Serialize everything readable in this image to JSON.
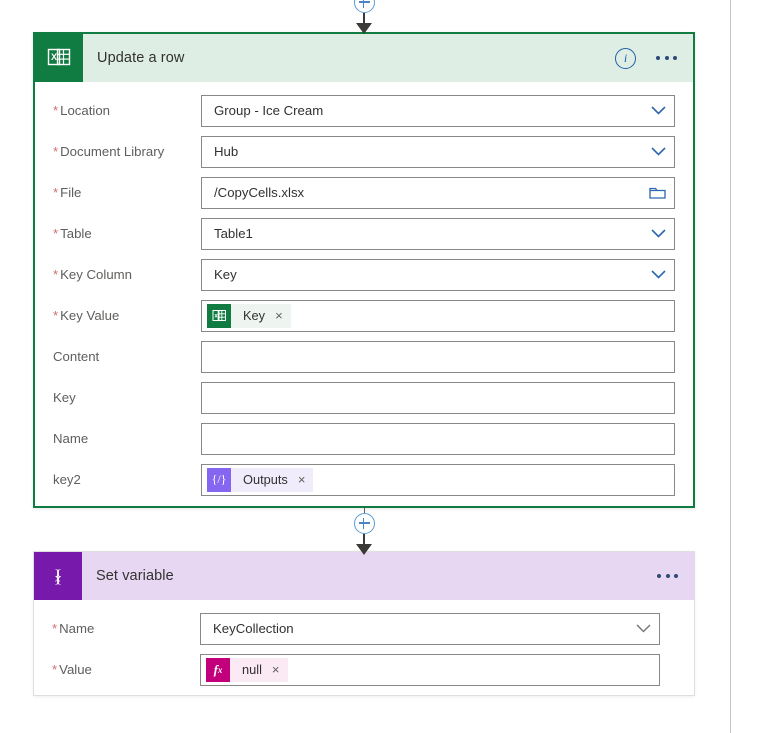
{
  "flow": {
    "connectors": [
      {
        "name": "connector-top",
        "icon": "plus-icon",
        "tooltip": "Insert a new step"
      },
      {
        "name": "connector-middle",
        "icon": "plus-icon",
        "tooltip": "Insert a new step"
      }
    ],
    "cards": [
      {
        "id": "update-a-row",
        "title": "Update a row",
        "icon": "excel-icon",
        "accent": "#107c41",
        "header_background": "#dfeee5",
        "selected": true,
        "header_buttons": [
          {
            "name": "info-button",
            "icon": "info-icon",
            "label": "i"
          },
          {
            "name": "more-commands-button",
            "icon": "ellipsis-icon",
            "label": "..."
          }
        ],
        "fields": [
          {
            "label": "Location",
            "required": true,
            "value": "Group - Ice Cream",
            "control": "dropdown"
          },
          {
            "label": "Document Library",
            "required": true,
            "value": "Hub",
            "control": "dropdown"
          },
          {
            "label": "File",
            "required": true,
            "value": "/CopyCells.xlsx",
            "control": "filepicker"
          },
          {
            "label": "Table",
            "required": true,
            "value": "Table1",
            "control": "dropdown"
          },
          {
            "label": "Key Column",
            "required": true,
            "value": "Key",
            "control": "dropdown"
          },
          {
            "label": "Key Value",
            "required": true,
            "value": "",
            "control": "token",
            "token": {
              "text": "Key",
              "icon": "excel-icon",
              "icon_color": "#107c41",
              "chip_color": "#eef5f0",
              "remove": "×"
            }
          },
          {
            "label": "Content",
            "required": false,
            "value": "",
            "control": "text"
          },
          {
            "label": "Key",
            "required": false,
            "value": "",
            "control": "text"
          },
          {
            "label": "Name",
            "required": false,
            "value": "",
            "control": "text"
          },
          {
            "label": "key2",
            "required": false,
            "value": "",
            "control": "token",
            "token": {
              "text": "Outputs",
              "icon": "code-icon",
              "icon_color": "#8566f0",
              "chip_color": "#f0ecfb",
              "remove": "×"
            }
          }
        ]
      },
      {
        "id": "set-variable",
        "title": "Set variable",
        "icon": "variable-icon",
        "accent": "#7719aa",
        "header_background": "#e8d7f3",
        "selected": false,
        "header_buttons": [
          {
            "name": "more-commands-button",
            "icon": "ellipsis-icon",
            "label": "..."
          }
        ],
        "fields": [
          {
            "label": "Name",
            "required": true,
            "value": "KeyCollection",
            "control": "dropdown"
          },
          {
            "label": "Value",
            "required": true,
            "value": "",
            "control": "token",
            "token": {
              "text": "null",
              "icon": "fx-icon",
              "icon_color": "#c2007b",
              "chip_color": "#fbe9f4",
              "remove": "×"
            }
          }
        ]
      }
    ]
  }
}
